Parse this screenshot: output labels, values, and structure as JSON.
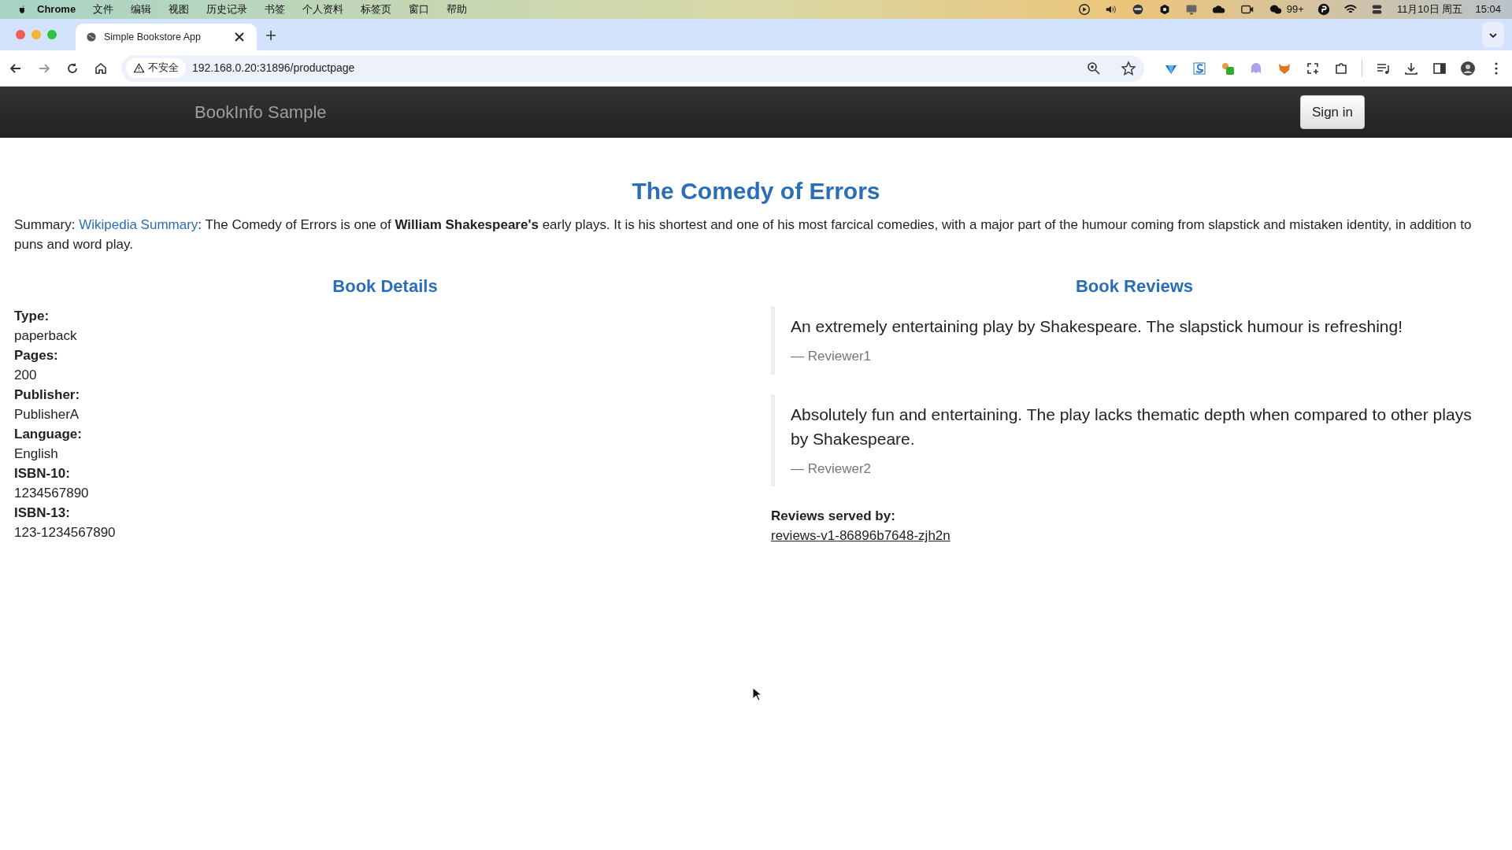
{
  "menubar": {
    "app": "Chrome",
    "menus": [
      "文件",
      "编辑",
      "视图",
      "历史记录",
      "书签",
      "个人资料",
      "标签页",
      "窗口",
      "帮助"
    ],
    "badge": "99+",
    "date": "11月10日 周五",
    "time": "15:04"
  },
  "browser": {
    "tab_title": "Simple Bookstore App",
    "security": "不安全",
    "url": "192.168.0.20:31896/productpage"
  },
  "navbar": {
    "brand": "BookInfo Sample",
    "sign_in": "Sign in"
  },
  "title": "The Comedy of Errors",
  "summary": {
    "prefix": "Summary: ",
    "link": "Wikipedia Summary",
    "text": ": The Comedy of Errors is one of **William Shakespeare's** early plays. It is his shortest and one of his most farcical comedies, with a major part of the humour coming from slapstick and mistaken identity, in addition to puns and word play."
  },
  "details": {
    "heading": "Book Details",
    "items": [
      {
        "label": "Type:",
        "value": "paperback"
      },
      {
        "label": "Pages:",
        "value": "200"
      },
      {
        "label": "Publisher:",
        "value": "PublisherA"
      },
      {
        "label": "Language:",
        "value": "English"
      },
      {
        "label": "ISBN-10:",
        "value": "1234567890"
      },
      {
        "label": "ISBN-13:",
        "value": "123-1234567890"
      }
    ]
  },
  "reviews": {
    "heading": "Book Reviews",
    "items": [
      {
        "text": "An extremely entertaining play by Shakespeare. The slapstick humour is refreshing!",
        "reviewer": "— Reviewer1"
      },
      {
        "text": "Absolutely fun and entertaining. The play lacks thematic depth when compared to other plays by Shakespeare.",
        "reviewer": "— Reviewer2"
      }
    ],
    "served_by_label": "Reviews served by:",
    "served_by": "reviews-v1-86896b7648-zjh2n"
  }
}
